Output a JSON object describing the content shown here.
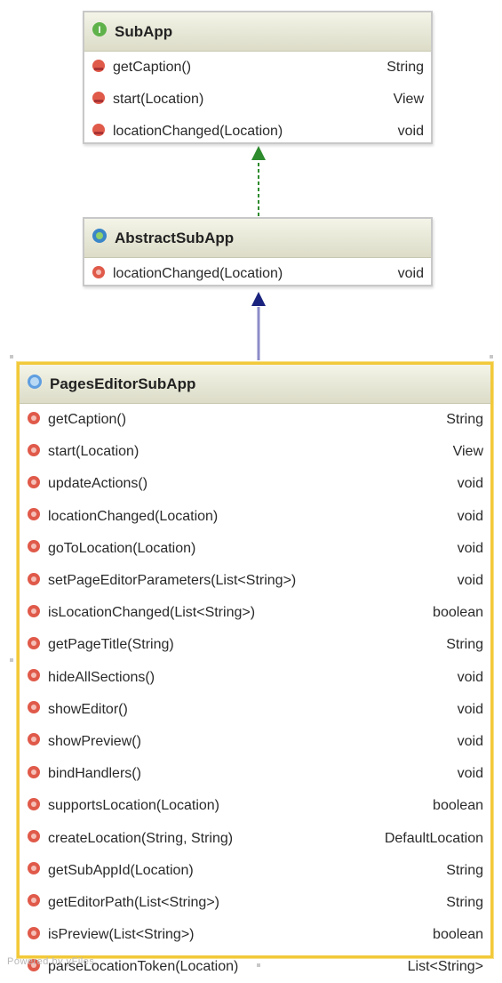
{
  "colors": {
    "interface_icon": "#5fb24a",
    "abstract_icon": "#3a86c8",
    "class_icon": "#5f9ee0",
    "method_icon": "#e05a4a",
    "realization_arrow": "#2e8b2e",
    "generalization_arrow": "#1a237e",
    "selected_border": "#f2c93a"
  },
  "classes": [
    {
      "name": "SubApp",
      "kind": "interface",
      "icon": "interface-icon",
      "methods": [
        {
          "name": "getCaption()",
          "type": "String"
        },
        {
          "name": "start(Location)",
          "type": "View"
        },
        {
          "name": "locationChanged(Location)",
          "type": "void"
        }
      ]
    },
    {
      "name": "AbstractSubApp",
      "kind": "abstract-class",
      "icon": "abstract-class-icon",
      "methods": [
        {
          "name": "locationChanged(Location)",
          "type": "void"
        }
      ]
    },
    {
      "name": "PagesEditorSubApp",
      "kind": "class",
      "icon": "class-icon",
      "selected": true,
      "methods": [
        {
          "name": "getCaption()",
          "type": "String"
        },
        {
          "name": "start(Location)",
          "type": "View"
        },
        {
          "name": "updateActions()",
          "type": "void"
        },
        {
          "name": "locationChanged(Location)",
          "type": "void"
        },
        {
          "name": "goToLocation(Location)",
          "type": "void"
        },
        {
          "name": "setPageEditorParameters(List<String>)",
          "type": "void"
        },
        {
          "name": "isLocationChanged(List<String>)",
          "type": "boolean"
        },
        {
          "name": "getPageTitle(String)",
          "type": "String"
        },
        {
          "name": "hideAllSections()",
          "type": "void"
        },
        {
          "name": "showEditor()",
          "type": "void"
        },
        {
          "name": "showPreview()",
          "type": "void"
        },
        {
          "name": "bindHandlers()",
          "type": "void"
        },
        {
          "name": "supportsLocation(Location)",
          "type": "boolean"
        },
        {
          "name": "createLocation(String, String)",
          "type": "DefaultLocation"
        },
        {
          "name": "getSubAppId(Location)",
          "type": "String"
        },
        {
          "name": "getEditorPath(List<String>)",
          "type": "String"
        },
        {
          "name": "isPreview(List<String>)",
          "type": "boolean"
        },
        {
          "name": "parseLocationToken(Location)",
          "type": "List<String>"
        }
      ]
    }
  ],
  "relationships": [
    {
      "from": "AbstractSubApp",
      "to": "SubApp",
      "kind": "realization"
    },
    {
      "from": "PagesEditorSubApp",
      "to": "AbstractSubApp",
      "kind": "generalization"
    }
  ],
  "watermark": "Powered by yFiles"
}
